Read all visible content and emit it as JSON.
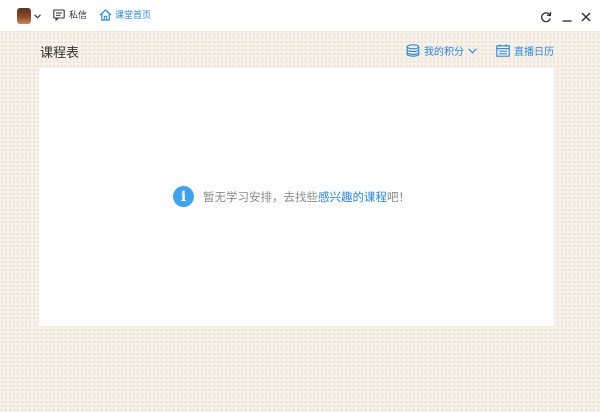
{
  "topbar": {
    "avatar_icon": "user-avatar",
    "messages_label": "私信",
    "home_label": "课堂首页",
    "controls": [
      "refresh-icon",
      "minimize-icon",
      "close-icon"
    ]
  },
  "header": {
    "title": "课程表",
    "points_label": "我的积分",
    "calendar_label": "直播日历"
  },
  "empty_state": {
    "text_before": "暂无学习安排，去找些",
    "link_text": "感兴趣的课程",
    "text_after": "吧！"
  },
  "colors": {
    "accent": "#2f86d8",
    "info": "#41a2ec"
  }
}
